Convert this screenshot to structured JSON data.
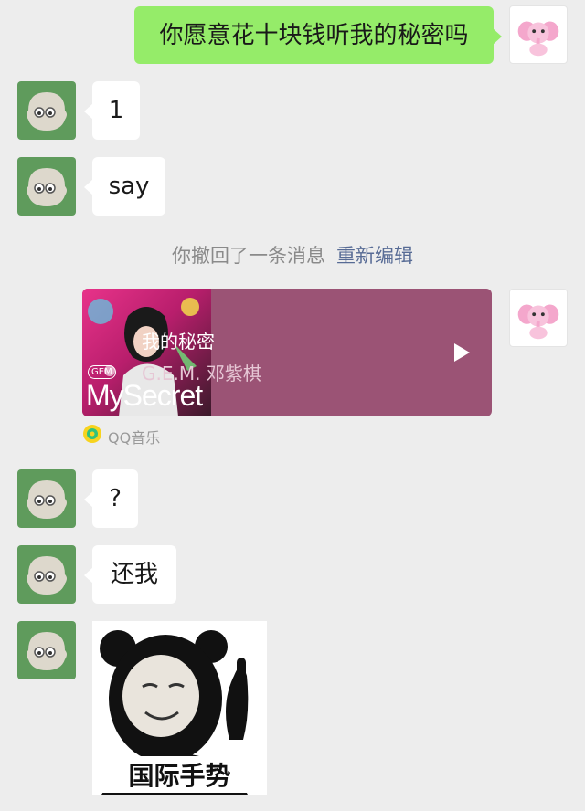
{
  "messages": {
    "m1": "你愿意花十块钱听我的秘密吗",
    "m2": "1",
    "m3": "say",
    "m4": "?",
    "m5": "还我"
  },
  "recall": {
    "text": "你撤回了一条消息",
    "reedit": "重新编辑"
  },
  "music": {
    "title": "我的秘密",
    "artist": "G.E.M. 邓紫棋",
    "cover_text": "MySecret",
    "cover_badge": "GEM",
    "source": "QQ音乐"
  },
  "meme": {
    "caption": "国际手势"
  },
  "colors": {
    "background": "#ededed",
    "sent_bubble": "#95ec69",
    "received_bubble": "#ffffff",
    "music_card": "#9b5375",
    "link": "#576b95"
  }
}
